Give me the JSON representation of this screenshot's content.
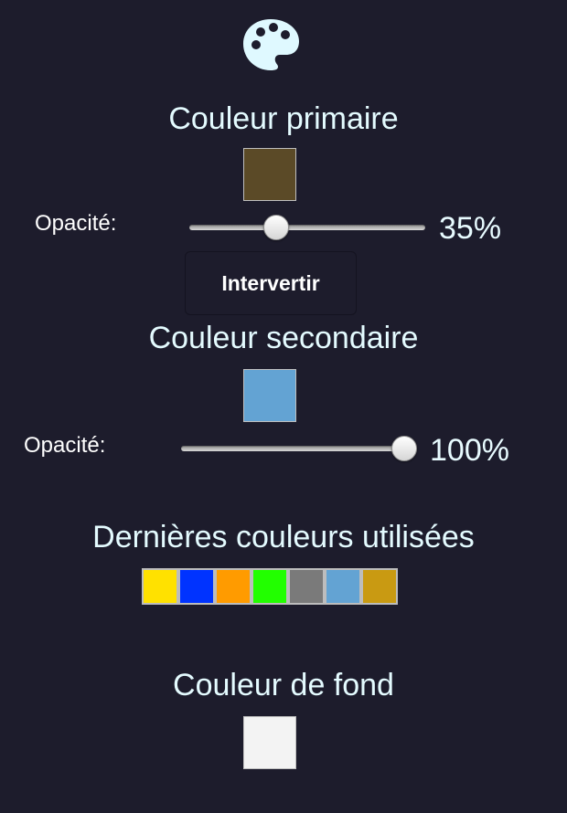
{
  "icon": "palette-icon",
  "primary": {
    "heading": "Couleur primaire",
    "color": "#5b4a27",
    "opacity_label": "Opacité:",
    "opacity": 0.35,
    "opacity_text": "35%"
  },
  "swap_label": "Intervertir",
  "secondary": {
    "heading": "Couleur secondaire",
    "color": "#63a3d3",
    "opacity_label": "Opacité:",
    "opacity": 1.0,
    "opacity_text": "100%"
  },
  "recent": {
    "heading": "Dernières couleurs utilisées",
    "colors": [
      "#ffe100",
      "#0033ff",
      "#ff9b00",
      "#22ff00",
      "#7a7a7a",
      "#63a3d3",
      "#c99a12"
    ]
  },
  "background": {
    "heading": "Couleur de fond",
    "color": "#f3f3f3"
  },
  "colors": {
    "page_background": "#1d1c2c",
    "heading_text": "#e4fbff",
    "icon_fill": "#dff9ff"
  }
}
